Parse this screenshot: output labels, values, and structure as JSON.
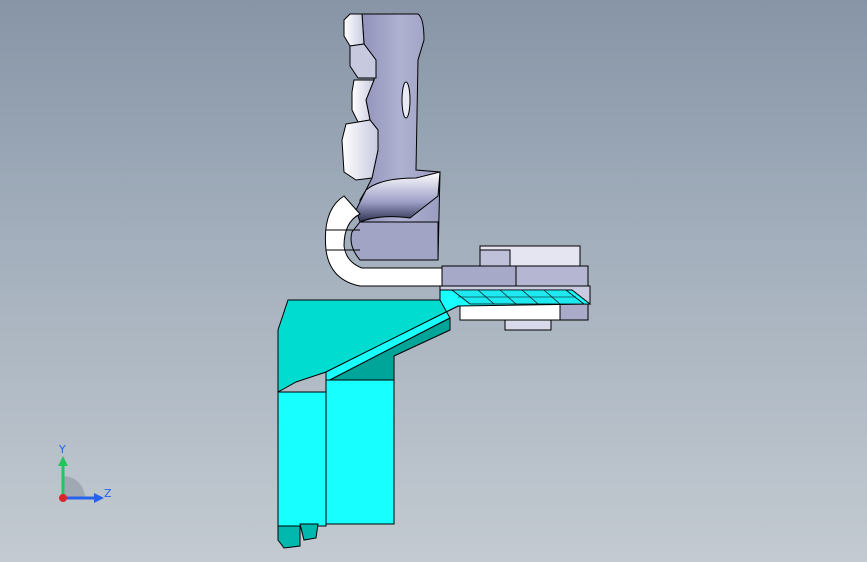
{
  "viewport": {
    "title": "",
    "background_top": "#8795a7",
    "background_bottom": "#c3cad1"
  },
  "model": {
    "arm_color": "#a7a9c9",
    "base_color": "#00ddd0",
    "base_light_color": "#18ffff",
    "base_dark_color": "#00a59a",
    "edge_color": "#000000"
  },
  "triad": {
    "x_label": "",
    "y_label": "Y",
    "z_label": "Z",
    "y_color": "#22c55e",
    "z_color": "#2563eb",
    "x_color": "#dc2626"
  }
}
